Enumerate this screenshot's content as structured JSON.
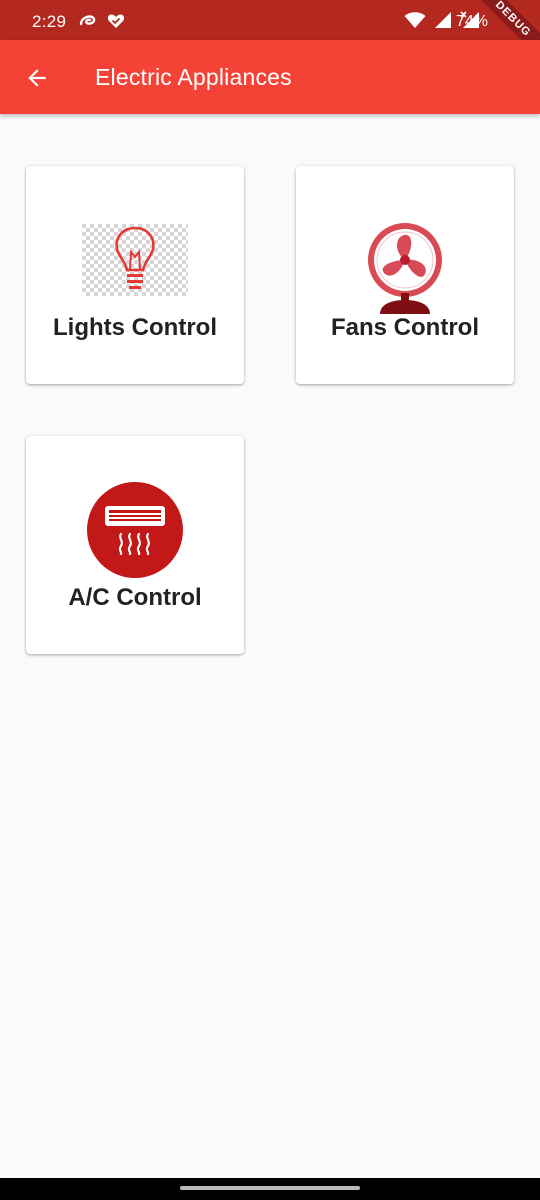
{
  "status_bar": {
    "time": "2:29",
    "battery": "74%",
    "debug_label": "DEBUG",
    "icons": [
      "airtel-icon",
      "heart-check-icon",
      "wifi-icon",
      "signal-icon",
      "signal-x-icon"
    ]
  },
  "app_bar": {
    "title": "Electric Appliances",
    "back_icon": "arrow-back-icon",
    "color": "#f44336"
  },
  "cards": [
    {
      "label": "Lights Control",
      "icon": "bulb-icon"
    },
    {
      "label": "Fans Control",
      "icon": "fan-icon"
    },
    {
      "label": "A/C Control",
      "icon": "ac-icon"
    }
  ],
  "colors": {
    "status_bar": "#b3281f",
    "accent_red": "#c21818",
    "background": "#fafafa"
  }
}
